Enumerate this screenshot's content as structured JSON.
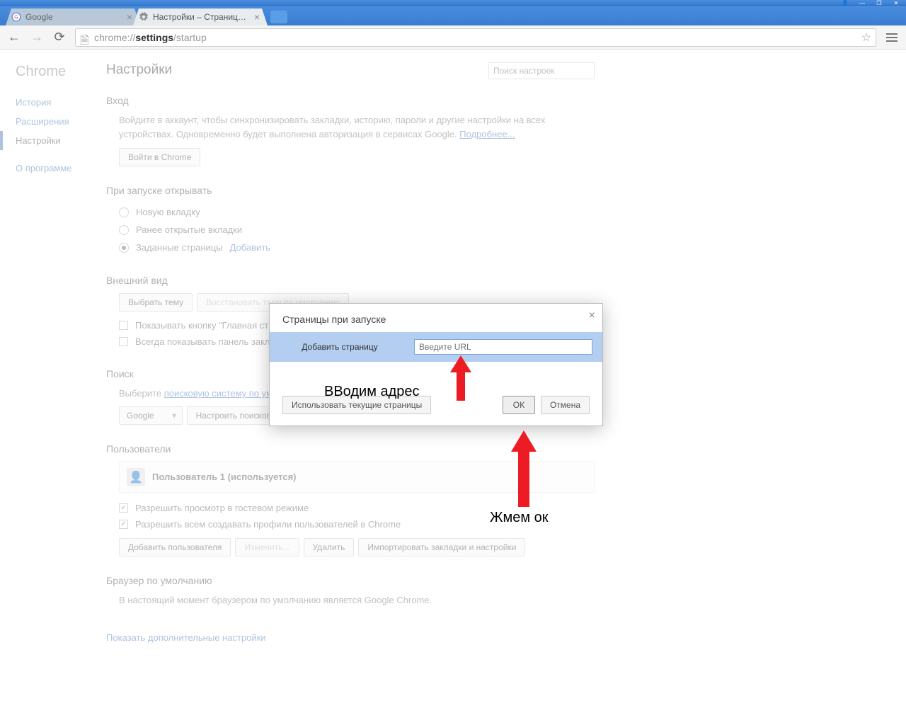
{
  "window": {
    "tabs": [
      {
        "title": "Google",
        "active": false
      },
      {
        "title": "Настройки – Страницы пр",
        "active": true
      }
    ]
  },
  "toolbar": {
    "url_prefix": "chrome://",
    "url_bold": "settings",
    "url_suffix": "/startup"
  },
  "sidebar": {
    "brand": "Chrome",
    "items": [
      "История",
      "Расширения",
      "Настройки"
    ],
    "about": "О программе"
  },
  "header": {
    "title": "Настройки",
    "search_placeholder": "Поиск настроек"
  },
  "signin": {
    "heading": "Вход",
    "text": "Войдите в аккаунт, чтобы синхронизировать закладки, историю, пароли и другие настройки на всех устройствах. Одновременно будет выполнена авторизация в сервисах Google. ",
    "more": "Подробнее...",
    "button": "Войти в Chrome"
  },
  "startup": {
    "heading": "При запуске открывать",
    "opt_newtab": "Новую вкладку",
    "opt_continue": "Ранее открытые вкладки",
    "opt_pages": "Заданные страницы",
    "add_link": "Добавить"
  },
  "appearance": {
    "heading": "Внешний вид",
    "choose_theme": "Выбрать тему",
    "reset_theme": "Восстановить тему по умолчанию",
    "show_home": "Показывать кнопку \"Главная страница\"",
    "show_bookmarks": "Всегда показывать панель закладок"
  },
  "search": {
    "heading": "Поиск",
    "desc_prefix": "Выберите ",
    "desc_link": "поисковую систему по умолчанию",
    "engine": "Google",
    "manage": "Настроить поисковые системы..."
  },
  "users": {
    "heading": "Пользователи",
    "current": "Пользователь 1 (используется)",
    "guest": "Разрешить просмотр в гостевом режиме",
    "allow_add": "Разрешить всем создавать профили пользователей в Chrome",
    "add": "Добавить пользователя",
    "edit": "Изменить...",
    "delete": "Удалить",
    "import": "Импортировать закладки и настройки"
  },
  "default_browser": {
    "heading": "Браузер по умолчанию",
    "text": "В настоящий момент браузером по умолчанию является Google Chrome."
  },
  "advanced_link": "Показать дополнительные настройки",
  "dialog": {
    "title": "Страницы при запуске",
    "add_label": "Добавить страницу",
    "url_placeholder": "Введите URL",
    "use_current": "Использовать текущие страницы",
    "ok": "ОК",
    "cancel": "Отмена"
  },
  "annotations": {
    "enter_address": "ВВодим адрес",
    "press_ok": "Жмем ок"
  }
}
